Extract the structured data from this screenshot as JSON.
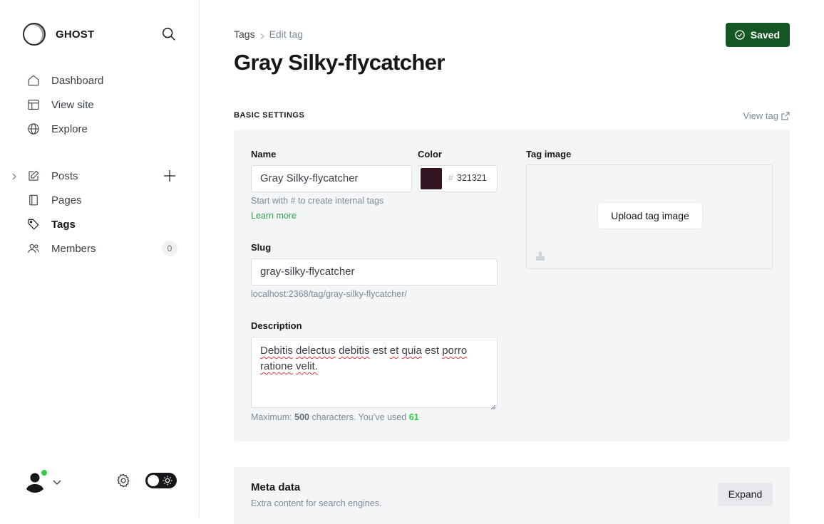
{
  "brand": {
    "name": "GHOST"
  },
  "icons": {
    "search": "search-icon",
    "dashboard": "home-icon",
    "view_site": "layout-icon",
    "explore": "globe-icon",
    "posts": "edit-icon",
    "pages": "pages-icon",
    "tags": "tag-icon",
    "members": "members-icon"
  },
  "nav": {
    "dashboard": "Dashboard",
    "view_site": "View site",
    "explore": "Explore",
    "posts": "Posts",
    "pages": "Pages",
    "tags": "Tags",
    "members": "Members",
    "members_count": "0"
  },
  "breadcrumb": {
    "parent": "Tags",
    "current": "Edit tag"
  },
  "page": {
    "title": "Gray Silky-flycatcher"
  },
  "save_button": {
    "label": "Saved"
  },
  "basic_settings": {
    "section_label": "BASIC SETTINGS",
    "view_tag": "View tag",
    "name_label": "Name",
    "name_value": "Gray Silky-flycatcher",
    "name_hint": "Start with # to create internal tags",
    "learn_more": "Learn more",
    "color_label": "Color",
    "color_hash": "#",
    "color_value": "321321",
    "slug_label": "Slug",
    "slug_value": "gray-silky-flycatcher",
    "slug_url": "localhost:2368/tag/gray-silky-flycatcher/",
    "description_label": "Description",
    "description_words": [
      "Debitis",
      "delectus",
      "debitis",
      "est",
      "et",
      "quia",
      "est",
      "porro",
      "ratione",
      "velit."
    ],
    "counter_prefix": "Maximum:",
    "counter_max": "500",
    "counter_mid": "characters. You’ve used",
    "counter_used": "61",
    "tag_image_label": "Tag image",
    "upload_label": "Upload tag image"
  },
  "meta": {
    "title": "Meta data",
    "subtitle": "Extra content for search engines.",
    "expand": "Expand"
  },
  "colors": {
    "accent_green": "#30cf43",
    "saved_button": "#155724",
    "swatch": "#321321"
  }
}
